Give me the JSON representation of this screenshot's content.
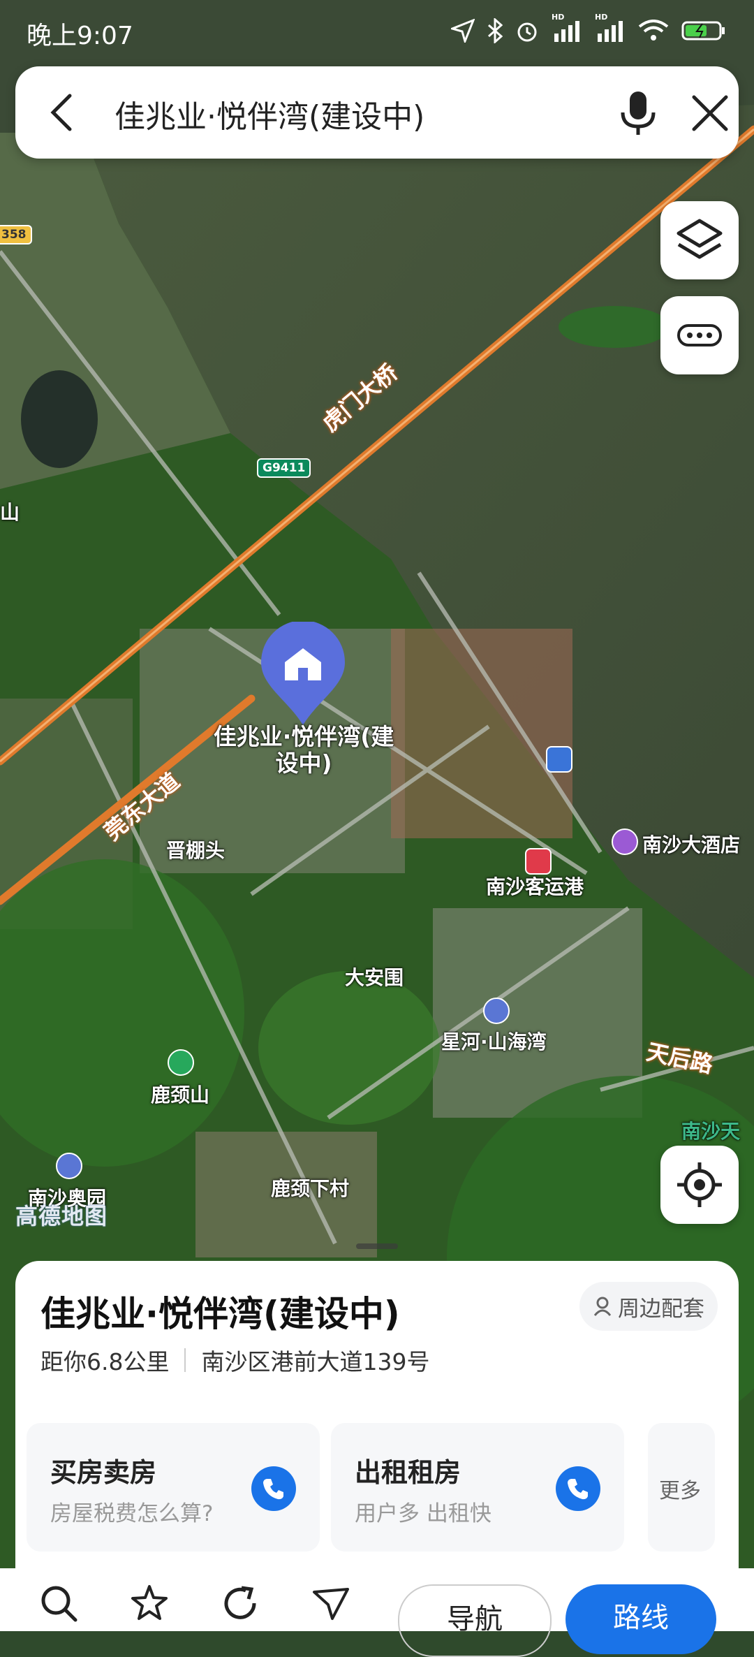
{
  "status_bar": {
    "time": "晚上9:07",
    "hd_label": "HD"
  },
  "search": {
    "query": "佳兆业·悦伴湾(建设中)"
  },
  "map": {
    "road_labels": {
      "bridge": "虎门大桥",
      "avenue": "莞东大道",
      "tianhou": "天后路"
    },
    "route_shields": {
      "g9411": "G9411",
      "s358": "358"
    },
    "place_labels": {
      "shan_edge": "山",
      "pengtou": "晋棚头",
      "daanwei": "大安围",
      "lujingshan": "鹿颈山",
      "lujingxiacun": "鹿颈下村",
      "nansha_park": "南沙奥园",
      "xinghe": "星河·山海湾",
      "passenger_port": "南沙客运港",
      "hotel": "南沙大酒店",
      "nansha_tian": "南沙天"
    },
    "pin_label": "佳兆业·悦伴湾(建设中)",
    "watermark": "高德地图"
  },
  "detail": {
    "title": "佳兆业·悦伴湾(建设中)",
    "nearby_label": "周边配套",
    "distance": "距你6.8公里",
    "address": "南沙区港前大道139号",
    "cards": [
      {
        "title": "买房卖房",
        "subtitle": "房屋税费怎么算?"
      },
      {
        "title": "出租租房",
        "subtitle": "用户多 出租快"
      }
    ],
    "more_label": "更多"
  },
  "bottom": {
    "nav_label": "导航",
    "route_label": "路线"
  },
  "colors": {
    "accent": "#1a73e8",
    "pin": "#5a6fdc",
    "road": "#e07a2c"
  }
}
